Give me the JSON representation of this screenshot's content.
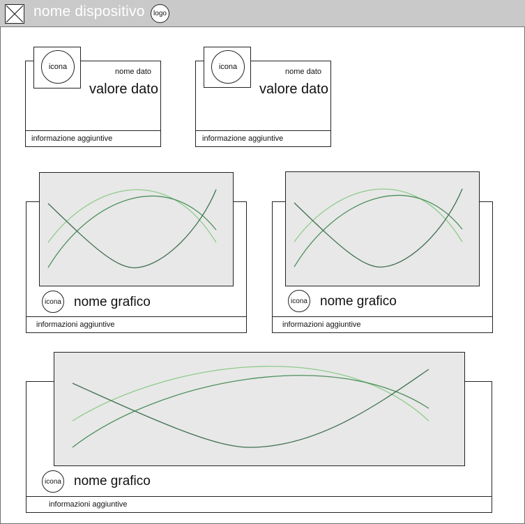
{
  "header": {
    "title": "nome dispositivo",
    "logo_label": "logo",
    "menu_icon": "close-x-icon"
  },
  "data_cards": [
    {
      "icon_label": "icona",
      "data_name": "nome dato",
      "data_value": "valore dato",
      "footer": "informazione aggiuntive"
    },
    {
      "icon_label": "icona",
      "data_name": "nome dato",
      "data_value": "valore dato",
      "footer": "informazione aggiuntive"
    }
  ],
  "chart_cards": [
    {
      "icon_label": "icona",
      "chart_name": "nome grafico",
      "footer": "informazioni aggiuntive"
    },
    {
      "icon_label": "icona",
      "chart_name": "nome grafico",
      "footer": "informazioni aggiuntive"
    },
    {
      "icon_label": "icona",
      "chart_name": "nome grafico",
      "footer": "informazioni aggiuntive"
    }
  ],
  "colors": {
    "chart_bg": "#e8e8e8",
    "line_dark": "#3f6f50",
    "line_mid": "#4c8f5c",
    "line_light": "#8ecb8a"
  }
}
